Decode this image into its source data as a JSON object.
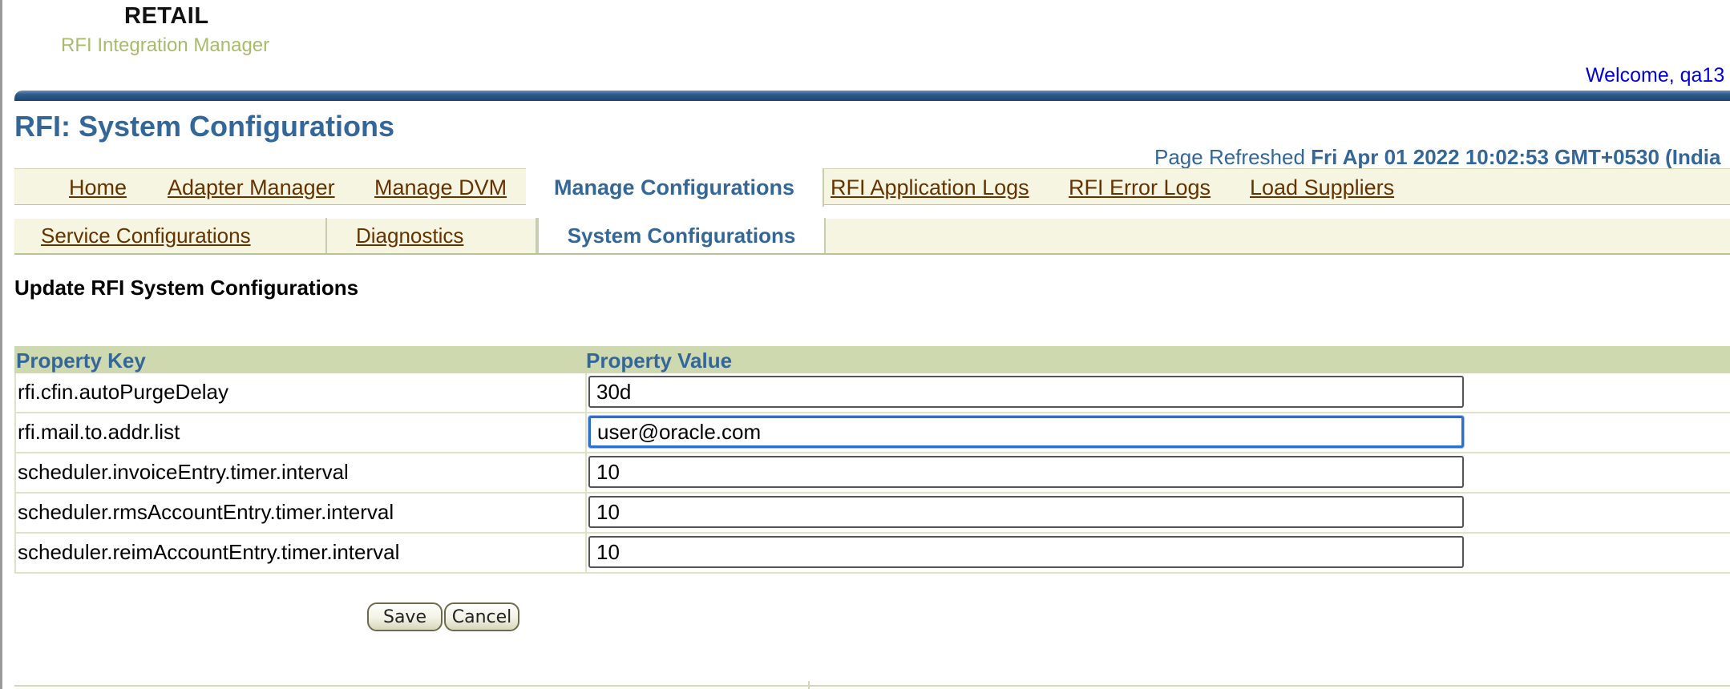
{
  "brand": {
    "company": "RETAIL",
    "product": "RFI Integration Manager"
  },
  "header": {
    "welcome": "Welcome, qa13",
    "page_title": "RFI: System Configurations",
    "refreshed_label": "Page Refreshed",
    "refreshed_value": "Fri Apr 01 2022 10:02:53 GMT+0530 (India"
  },
  "tabs": [
    {
      "label": "Home"
    },
    {
      "label": "Adapter Manager"
    },
    {
      "label": "Manage DVM"
    },
    {
      "label": "Manage Configurations",
      "selected": true
    },
    {
      "label": "RFI Application Logs"
    },
    {
      "label": "RFI Error Logs"
    },
    {
      "label": "Load Suppliers"
    }
  ],
  "subtabs": [
    {
      "label": "Service Configurations"
    },
    {
      "label": "Diagnostics"
    },
    {
      "label": "System Configurations",
      "selected": true
    }
  ],
  "section_heading": "Update RFI System Configurations",
  "table": {
    "columns": [
      "Property Key",
      "Property Value"
    ],
    "rows": [
      {
        "key": "rfi.cfin.autoPurgeDelay",
        "value": "30d"
      },
      {
        "key": "rfi.mail.to.addr.list",
        "value": "user@oracle.com",
        "focused": true
      },
      {
        "key": "scheduler.invoiceEntry.timer.interval",
        "value": "10"
      },
      {
        "key": "scheduler.rmsAccountEntry.timer.interval",
        "value": "10"
      },
      {
        "key": "scheduler.reimAccountEntry.timer.interval",
        "value": "10"
      }
    ]
  },
  "buttons": {
    "save": "Save",
    "cancel": "Cancel"
  },
  "colors": {
    "title_blue": "#336699",
    "tab_link_brown": "#663300",
    "header_row_green": "#cfd9b0",
    "tab_bar_cream": "#f5f5e1",
    "welcome_blue": "#0000dd"
  }
}
